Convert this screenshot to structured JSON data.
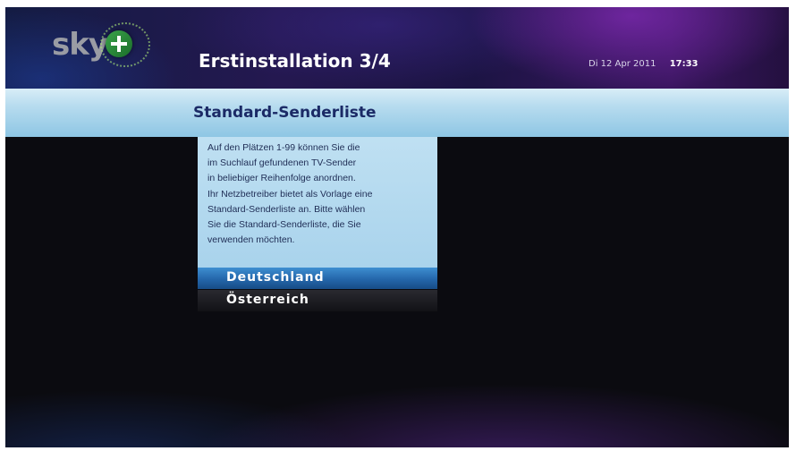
{
  "header": {
    "logo_text": "sky",
    "title": "Erstinstallation 3/4",
    "date": "Di 12 Apr 2011",
    "time": "17:33"
  },
  "section": {
    "title": "Standard-Senderliste"
  },
  "info": {
    "lines": [
      "Auf den Plätzen 1-99 können Sie die",
      "im Suchlauf gefundenen TV-Sender",
      "in beliebiger Reihenfolge anordnen.",
      "Ihr Netzbetreiber bietet als Vorlage eine",
      "Standard-Senderliste an. Bitte wählen",
      "Sie die Standard-Senderliste, die Sie",
      "verwenden möchten."
    ]
  },
  "list": {
    "items": [
      {
        "label": "Deutschland",
        "selected": true
      },
      {
        "label": "Österreich",
        "selected": false
      }
    ]
  },
  "colors": {
    "accent_blue": "#2466aa",
    "panel_light_blue": "#bfe0f2",
    "text_dark_blue": "#1b2a66",
    "logo_plus_green": "#3aa34a"
  },
  "icons": {
    "logo": "sky-plus-logo-icon"
  }
}
